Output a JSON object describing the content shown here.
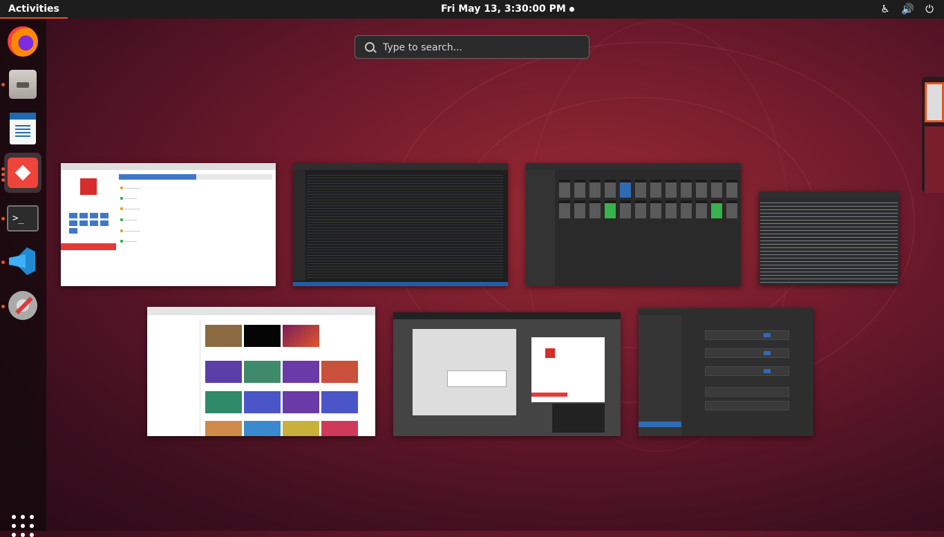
{
  "topbar": {
    "activities": "Activities",
    "clock": "Fri May 13,  3:30:00 PM"
  },
  "tray": {
    "icons": [
      "accessibility-icon",
      "volume-icon",
      "power-icon"
    ]
  },
  "search": {
    "placeholder": "Type to search..."
  },
  "dock": {
    "apps": [
      "firefox",
      "files",
      "libreoffice-writer",
      "anydesk",
      "terminal",
      "vscode",
      "tweaks"
    ],
    "show_applications": "show-applications"
  },
  "colors": {
    "accent": "#e95420",
    "anydesk_red": "#ef443b",
    "panel": "#1d1d1d"
  }
}
